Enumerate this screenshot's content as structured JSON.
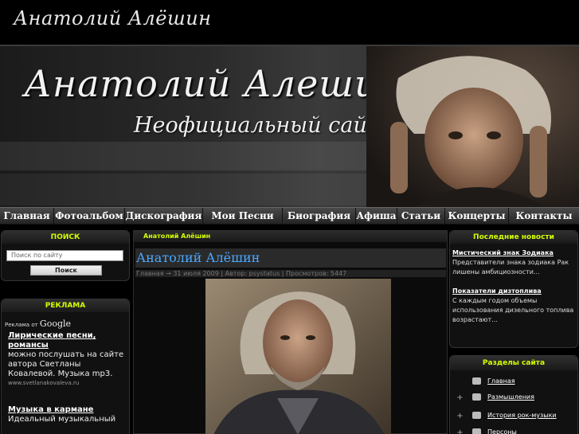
{
  "header": {
    "site_title": "Анатолий Алёшин"
  },
  "banner": {
    "name": "Анатолий Алешин",
    "subtitle": "Неофициальный сайт"
  },
  "nav": {
    "items": [
      "Главная",
      "Фотоальбом",
      "Дискография",
      "Мои Песни",
      "Биография",
      "Афиша",
      "Статьи",
      "Концерты",
      "Контакты"
    ]
  },
  "search": {
    "title": "ПОИСК",
    "placeholder": "Поиск по сайту",
    "button": "Поиск"
  },
  "ads": {
    "title": "РЕКЛАМА",
    "by_label": "Реклама от",
    "by_brand": "Google",
    "items": [
      {
        "link": "Лирические песни, романсы",
        "text": "можно послушать на сайте автора Светланы Ковалевой. Музыка mp3.",
        "url": "www.svetlanakovaleva.ru"
      },
      {
        "link": "Музыка в кармане",
        "text": "Идеальный музыкальный",
        "url": ""
      }
    ]
  },
  "article": {
    "breadcrumb": "Анатолий Алёшин",
    "title": "Анатолий Алёшин",
    "meta": "Главная → 31 июля 2009 | Автор: psystatus | Просмотров: 5447"
  },
  "news": {
    "title": "Последние новости",
    "items": [
      {
        "link": "Мистический знак Зодиака",
        "text": "Представители знака зодиака Рак лишены амбициозности..."
      },
      {
        "link": "Показатели дизтоплива",
        "text": "С каждым годом объемы использования дизельного топлива возрастают..."
      }
    ]
  },
  "sections": {
    "title": "Разделы сайта",
    "items": [
      {
        "label": "Главная",
        "expandable": false
      },
      {
        "label": "Размышления",
        "expandable": true
      },
      {
        "label": "История рок-музыки",
        "expandable": true
      },
      {
        "label": "Персоны",
        "expandable": true
      }
    ]
  },
  "colors": {
    "panel_title": "#d4ff00",
    "article_title": "#4aa8ff",
    "background": "#000000"
  }
}
